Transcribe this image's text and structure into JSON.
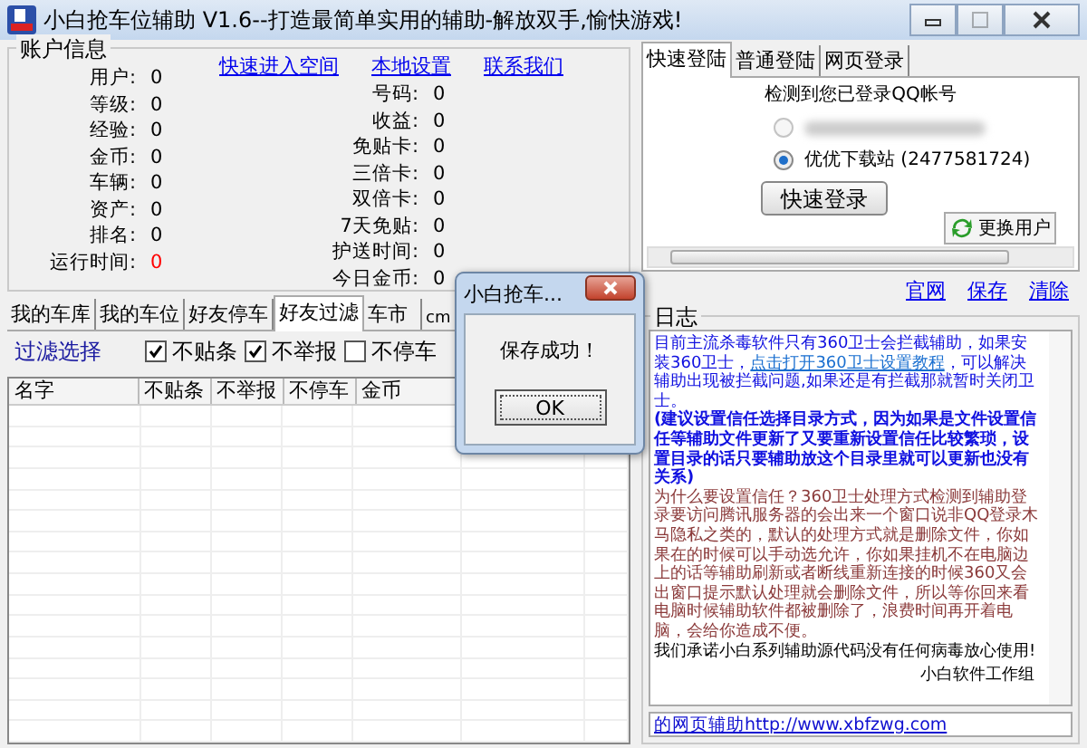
{
  "window": {
    "title": "小白抢车位辅助 V1.6--打造最简单实用的辅助-解放双手,愉快游戏!",
    "controls": [
      {
        "kind": "minimize",
        "disabled": false
      },
      {
        "kind": "maximize",
        "disabled": true
      },
      {
        "kind": "close",
        "disabled": false
      }
    ]
  },
  "account": {
    "title": "账户信息",
    "links": [
      "快速进入空间",
      "本地设置",
      "联系我们"
    ],
    "left_fields": [
      {
        "label": "用户:",
        "value": "0",
        "color": "#000000"
      },
      {
        "label": "等级:",
        "value": "0",
        "color": "#000000"
      },
      {
        "label": "经验:",
        "value": "0",
        "color": "#000000"
      },
      {
        "label": "金币:",
        "value": "0",
        "color": "#000000"
      },
      {
        "label": "车辆:",
        "value": "0",
        "color": "#000000"
      },
      {
        "label": "资产:",
        "value": "0",
        "color": "#000000"
      },
      {
        "label": "排名:",
        "value": "0",
        "color": "#000000"
      },
      {
        "label": "运行时间:",
        "value": "0",
        "color": "#ff0000"
      }
    ],
    "right_fields": [
      {
        "label": "号码:",
        "value": "0",
        "color": "#000000"
      },
      {
        "label": "收益:",
        "value": "0",
        "color": "#000000"
      },
      {
        "label": "免贴卡:",
        "value": "0",
        "color": "#000000"
      },
      {
        "label": "三倍卡:",
        "value": "0",
        "color": "#000000"
      },
      {
        "label": "双倍卡:",
        "value": "0",
        "color": "#000000"
      },
      {
        "label": "7天免贴:",
        "value": "0",
        "color": "#000000"
      },
      {
        "label": "护送时间:",
        "value": "0",
        "color": "#000000"
      },
      {
        "label": "今日金币:",
        "value": "0",
        "color": "#000000"
      }
    ]
  },
  "main_tabs": [
    {
      "label": "我的车库",
      "selected": false
    },
    {
      "label": "我的车位",
      "selected": false
    },
    {
      "label": "好友停车",
      "selected": false
    },
    {
      "label": "好友过滤",
      "selected": true
    },
    {
      "label": "车市",
      "selected": false
    },
    {
      "label": "cm",
      "selected": false
    }
  ],
  "filter": {
    "label": "过滤选择",
    "options": [
      {
        "label": "不贴条",
        "checked": true
      },
      {
        "label": "不举报",
        "checked": true
      },
      {
        "label": "不停车",
        "checked": false
      }
    ]
  },
  "table": {
    "columns": [
      "名字",
      "不贴条",
      "不举报",
      "不停车",
      "金币"
    ]
  },
  "login_tabs": [
    {
      "label": "快速登陆",
      "selected": true
    },
    {
      "label": "普通登陆",
      "selected": false
    },
    {
      "label": "网页登录",
      "selected": false
    }
  ],
  "login": {
    "heading": "检测到您已登录QQ帐号",
    "accounts": [
      {
        "selected": false,
        "redacted": true
      },
      {
        "label": "优优下载站 (2477581724)",
        "selected": true,
        "redacted": false
      }
    ],
    "login_button": "快速登录",
    "switch_button": "更换用户"
  },
  "log_links": [
    "官网",
    "保存",
    "清除"
  ],
  "log": {
    "title": "日志",
    "paragraphs": [
      {
        "kind": "notice",
        "segments": [
          {
            "text": "目前主流杀毒软件只有360卫士会拦截辅助，如果安装360卫士，",
            "link": false
          },
          {
            "text": "点击打开360卫士设置教程",
            "link": true
          },
          {
            "text": "，可以解决辅助出现被拦截问题,如果还是有拦截那就暂时关闭卫士。",
            "link": false
          }
        ]
      },
      {
        "kind": "emphasis",
        "segments": [
          {
            "text": "(建议设置信任选择目录方式，因为如果是文件设置信任等辅助文件更新了又要重新设置信任比较繁琐，设置目录的话只要辅助放这个目录里就可以更新也没有关系)",
            "link": false
          }
        ]
      },
      {
        "kind": "warning",
        "segments": [
          {
            "text": "为什么要设置信任？360卫士处理方式检测到辅助登录要访问腾讯服务器的会出来一个窗口说非QQ登录木马隐私之类的，默认的处理方式就是删除文件，你如果在的时候可以手动选允许，你如果挂机不在电脑边上的话等辅助刷新或者断线重新连接的时候360又会出窗口提示默认处理就会删除文件，所以等你回来看电脑时候辅助软件都被删除了，浪费时间再开着电脑，会给你造成不便。",
            "link": false
          }
        ]
      },
      {
        "kind": "plain",
        "segments": [
          {
            "text": "我们承诺小白系列辅助源代码没有任何病毒放心使用!",
            "link": false
          }
        ]
      },
      {
        "kind": "signature",
        "segments": [
          {
            "text": "小白软件工作组",
            "link": false
          }
        ]
      }
    ],
    "footer_field": "的网页辅助http://www.xbfzwg.com"
  },
  "dialog": {
    "title": "小白抢车...",
    "message": "保存成功！",
    "ok_button": "OK"
  }
}
